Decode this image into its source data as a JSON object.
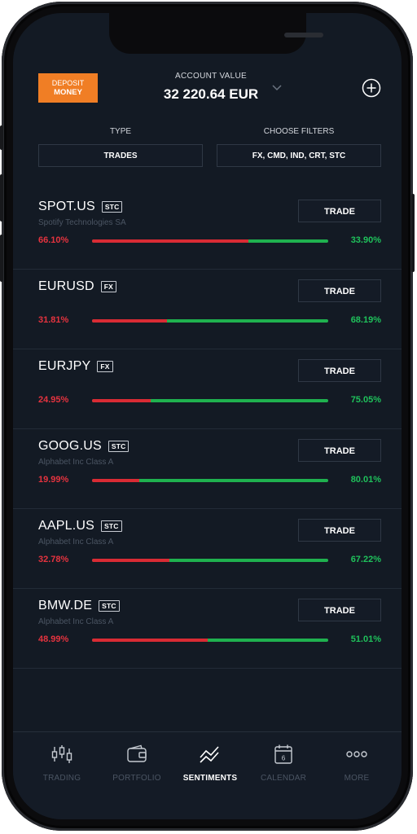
{
  "header": {
    "deposit_line1": "DEPOSIT",
    "deposit_line2": "MONEY",
    "account_label": "ACCOUNT VALUE",
    "account_value": "32 220.64 EUR"
  },
  "filters": {
    "type_label": "TYPE",
    "type_value": "TRADES",
    "choose_label": "CHOOSE FILTERS",
    "choose_value": "FX, CMD, IND, CRT, STC"
  },
  "instruments": [
    {
      "symbol": "SPOT.US",
      "badge": "STC",
      "name": "Spotify Technologies SA",
      "sell_pct": "66.10%",
      "buy_pct": "33.90%",
      "sell_value": 66.1,
      "trade_label": "TRADE"
    },
    {
      "symbol": "EURUSD",
      "badge": "FX",
      "name": "",
      "sell_pct": "31.81%",
      "buy_pct": "68.19%",
      "sell_value": 31.81,
      "trade_label": "TRADE"
    },
    {
      "symbol": "EURJPY",
      "badge": "FX",
      "name": "",
      "sell_pct": "24.95%",
      "buy_pct": "75.05%",
      "sell_value": 24.95,
      "trade_label": "TRADE"
    },
    {
      "symbol": "GOOG.US",
      "badge": "STC",
      "name": "Alphabet Inc Class A",
      "sell_pct": "19.99%",
      "buy_pct": "80.01%",
      "sell_value": 19.99,
      "trade_label": "TRADE"
    },
    {
      "symbol": "AAPL.US",
      "badge": "STC",
      "name": "Alphabet Inc Class A",
      "sell_pct": "32.78%",
      "buy_pct": "67.22%",
      "sell_value": 32.78,
      "trade_label": "TRADE"
    },
    {
      "symbol": "BMW.DE",
      "badge": "STC",
      "name": "Alphabet Inc Class A",
      "sell_pct": "48.99%",
      "buy_pct": "51.01%",
      "sell_value": 48.99,
      "trade_label": "TRADE"
    }
  ],
  "tabs": [
    {
      "label": "TRADING",
      "icon": "trading-icon"
    },
    {
      "label": "PORTFOLIO",
      "icon": "wallet-icon"
    },
    {
      "label": "SENTIMENTS",
      "icon": "sentiments-icon",
      "active": true
    },
    {
      "label": "CALENDAR",
      "icon": "calendar-icon",
      "day": "6"
    },
    {
      "label": "MORE",
      "icon": "more-icon"
    }
  ],
  "colors": {
    "accent": "#f07e25",
    "sell": "#d92b34",
    "buy": "#1fb14f",
    "background": "#131a24"
  }
}
